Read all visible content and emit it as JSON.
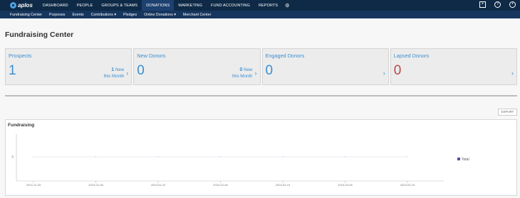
{
  "nav": {
    "logo_text": "aplos",
    "items": [
      "DASHBOARD",
      "PEOPLE",
      "GROUPS & TEAMS",
      "DONATIONS",
      "MARKETING",
      "FUND ACCOUNTING",
      "REPORTS"
    ],
    "active": "DONATIONS",
    "icons": [
      "gear-icon",
      "plus-square-icon",
      "help-icon",
      "user-circle-icon"
    ]
  },
  "subnav": {
    "items": [
      "Fundraising Center",
      "Purposes",
      "Events",
      "Contributions ▾",
      "Pledges",
      "Online Donations ▾",
      "Merchant Center"
    ]
  },
  "page": {
    "title": "Fundraising Center"
  },
  "cards": [
    {
      "title": "Prospects",
      "value": "1",
      "new_num": "1",
      "new_label": "New",
      "new_period": "this Month",
      "arrow": "›",
      "value_color": "#3b8ed1"
    },
    {
      "title": "New Donors",
      "value": "0",
      "new_num": "0",
      "new_label": "New",
      "new_period": "this Month",
      "arrow": "›",
      "value_color": "#3b8ed1"
    },
    {
      "title": "Engaged Donors",
      "value": "0",
      "arrow": "›",
      "value_color": "#3b8ed1"
    },
    {
      "title": "Lapsed Donors",
      "value": "0",
      "arrow": "›",
      "value_color": "#b84a4a"
    }
  ],
  "export_label": "EXPORT",
  "chart_panel": {
    "title": "Fundraising"
  },
  "chart_data": {
    "type": "line",
    "title": "Fundraising",
    "x": [
      "2022-12-25",
      "2023-01-08",
      "2023-01-22",
      "2023-02-05",
      "2023-02-19",
      "2023-03-05",
      "2023-03-19"
    ],
    "series": [
      {
        "name": "Total",
        "values": [
          0,
          0,
          0,
          0,
          0,
          0,
          0
        ],
        "color": "#5a4fa8"
      }
    ],
    "yticks": [
      "0"
    ],
    "legend": "right",
    "grid": false
  }
}
